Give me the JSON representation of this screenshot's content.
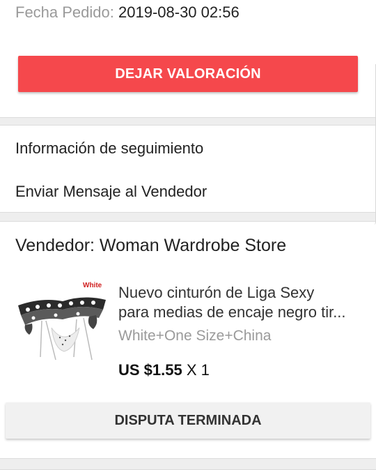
{
  "order": {
    "date_label": "Fecha Pedido:",
    "date_value": "2019-08-30 02:56",
    "review_button": "DEJAR VALORACIÓN"
  },
  "menu": {
    "tracking": "Información de seguimiento",
    "message_seller": "Enviar Mensaje al Vendedor"
  },
  "seller": {
    "label": "Vendedor: Woman Wardrobe Store"
  },
  "product": {
    "image_tag": "White",
    "title_line1": "Nuevo cinturón de Liga Sexy",
    "title_line2": "para medias de encaje negro tir...",
    "variant": "White+One Size+China",
    "price": "US $1.55",
    "quantity": "X 1",
    "dispute_button": "DISPUTA TERMINADA"
  },
  "colors": {
    "accent": "#f5484c",
    "muted_text": "#9a9a9a",
    "separator": "#eeeeee"
  }
}
